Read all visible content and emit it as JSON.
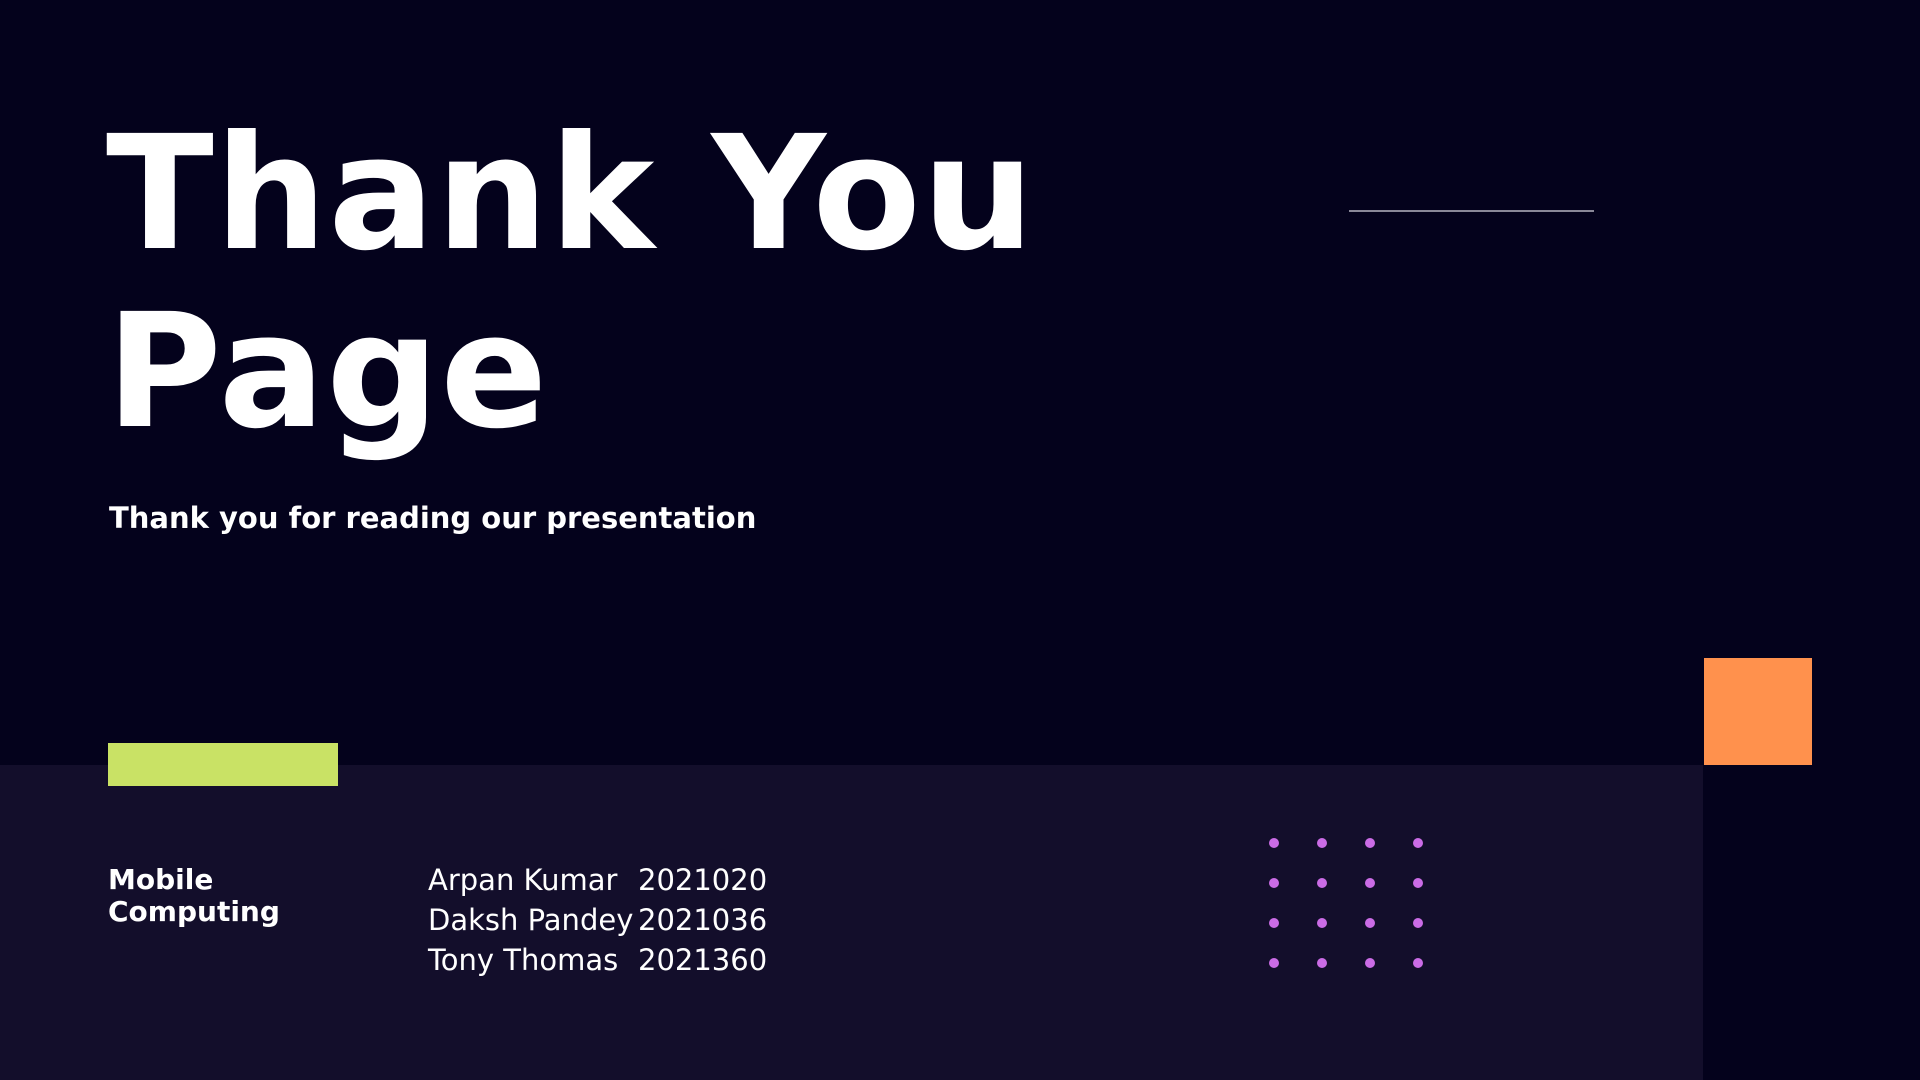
{
  "title_lines": [
    "Thank You",
    "Page"
  ],
  "subtitle": "Thank you for reading our presentation",
  "course": "Mobile Computing",
  "members": [
    {
      "name": "Arpan Kumar",
      "id": "2021020"
    },
    {
      "name": "Daksh Pandey",
      "id": "2021036"
    },
    {
      "name": "Tony Thomas",
      "id": "2021360"
    }
  ],
  "colors": {
    "background": "#04021c",
    "panel": "#130e2b",
    "accent_green": "#c9e265",
    "accent_orange": "#ff914d",
    "dots": "#cb6ce6",
    "text": "#ffffff"
  }
}
